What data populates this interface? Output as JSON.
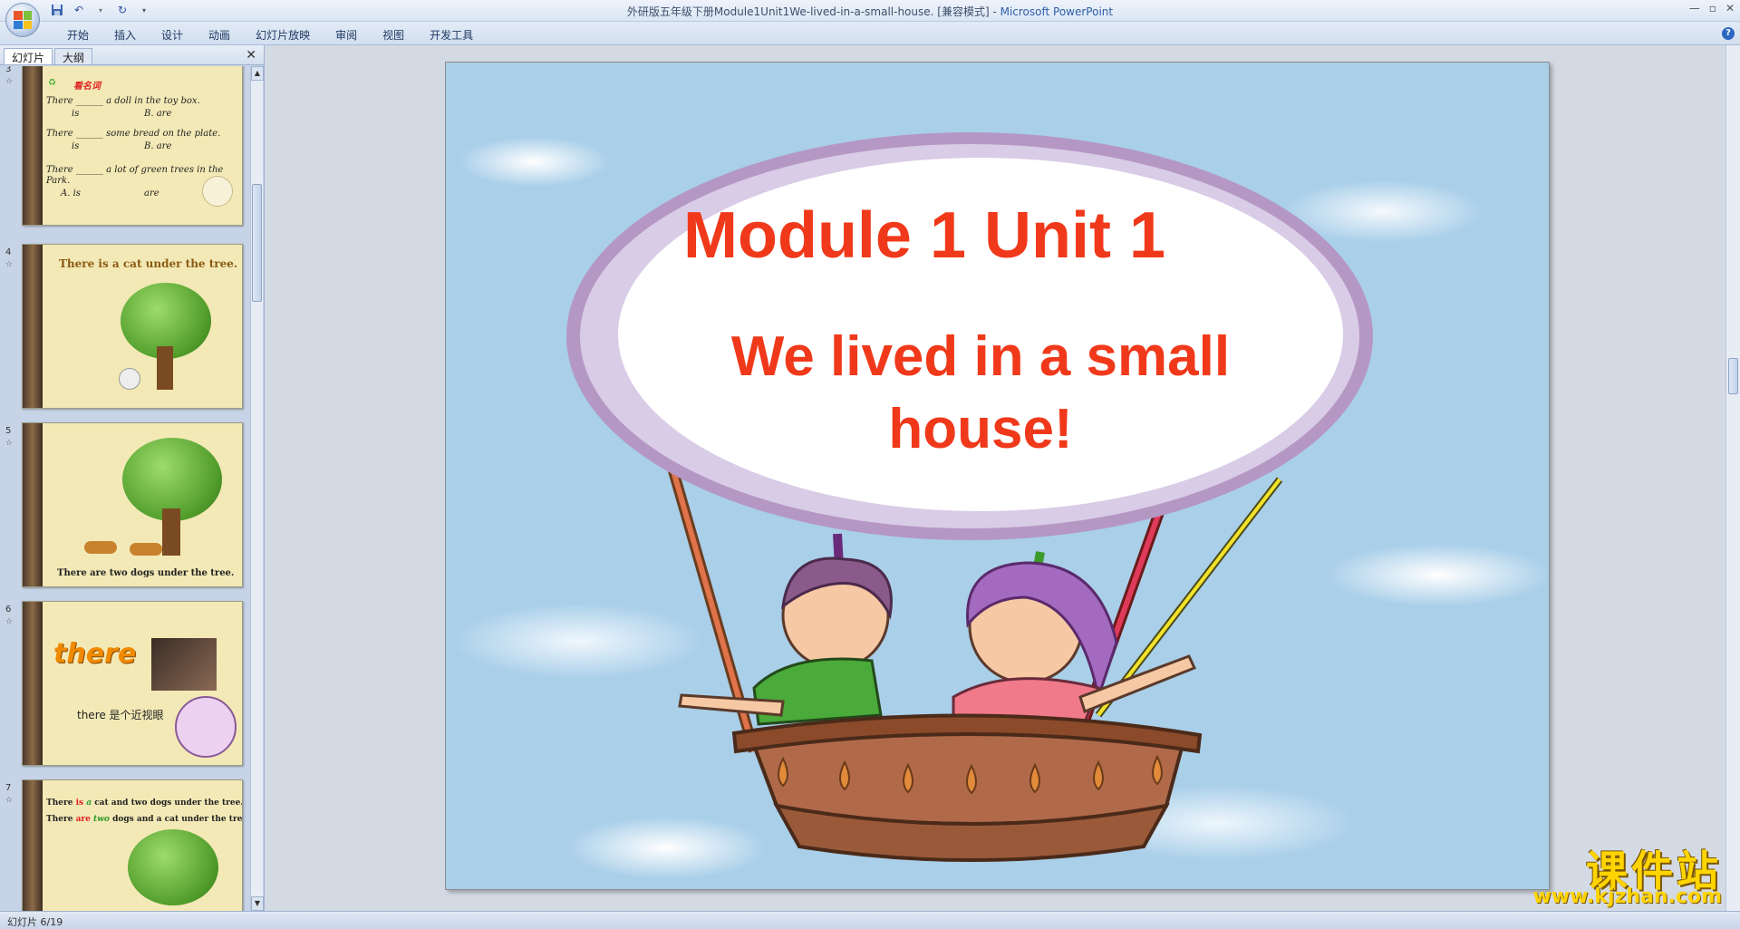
{
  "window": {
    "title": "外研版五年级下册Module1Unit1We-lived-in-a-small-house. [兼容模式] - ",
    "app_name": "Microsoft PowerPoint"
  },
  "ribbon": {
    "tabs": [
      "开始",
      "插入",
      "设计",
      "动画",
      "幻灯片放映",
      "审阅",
      "视图",
      "开发工具"
    ]
  },
  "left_pane": {
    "tabs": [
      "幻灯片",
      "大纲"
    ],
    "close": "✕"
  },
  "thumbnails": [
    {
      "number": "3",
      "heading": "看名词",
      "lines": [
        "There ______ a doll in the toy box.",
        "is",
        "B. are",
        "There ______ some bread on the plate.",
        "is",
        "B. are",
        "There ______ a lot of green trees in the",
        "Park.",
        "A. is",
        "are"
      ]
    },
    {
      "number": "4",
      "text": "There is a cat under the tree."
    },
    {
      "number": "5",
      "text": "There are two dogs under the tree."
    },
    {
      "number": "6",
      "big_word": "there",
      "caption": "there 是个近视眼"
    },
    {
      "number": "7",
      "line1_a": "There",
      "line1_b": "is",
      "line1_c": "a",
      "line1_d": "cat and two dogs under the tree.",
      "line2_a": "There",
      "line2_b": "are",
      "line2_c": "two",
      "line2_d": "dogs and a cat under the tree."
    }
  ],
  "slide": {
    "title": "Module 1 Unit 1",
    "subtitle": "We lived in a small house!"
  },
  "status": {
    "slide_counter": "幻灯片 6/19"
  },
  "watermark": {
    "cn": "课件站",
    "url": "www.kjzhan.com"
  },
  "colors": {
    "title_red": "#f0391a",
    "sky": "#a9cfe9",
    "thumb_bg": "#f3e9b6"
  }
}
